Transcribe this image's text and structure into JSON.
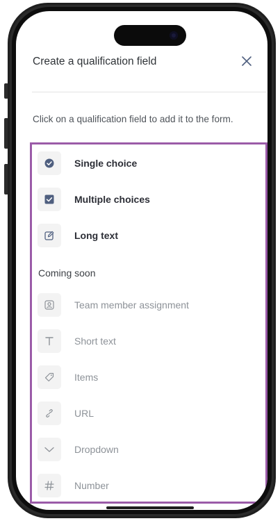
{
  "panel": {
    "title": "Create a qualification field",
    "instruction": "Click on a qualification field to add it to the form."
  },
  "fields": [
    {
      "label": "Single choice",
      "icon": "radio-checked-icon",
      "state": "active"
    },
    {
      "label": "Multiple choices",
      "icon": "checkbox-checked-icon",
      "state": "active"
    },
    {
      "label": "Long text",
      "icon": "edit-icon",
      "state": "active"
    }
  ],
  "coming_soon": {
    "label": "Coming soon",
    "items": [
      {
        "label": "Team member assignment",
        "icon": "user-badge-icon"
      },
      {
        "label": "Short text",
        "icon": "text-t-icon"
      },
      {
        "label": "Items",
        "icon": "tag-icon"
      },
      {
        "label": "URL",
        "icon": "link-icon"
      },
      {
        "label": "Dropdown",
        "icon": "chevron-down-icon"
      },
      {
        "label": "Number",
        "icon": "hash-icon"
      }
    ]
  },
  "colors": {
    "highlight_border": "#9b5ba8",
    "active_icon": "#4f5f7f",
    "disabled_icon": "#8d9298",
    "icon_background": "#f3f3f3"
  }
}
